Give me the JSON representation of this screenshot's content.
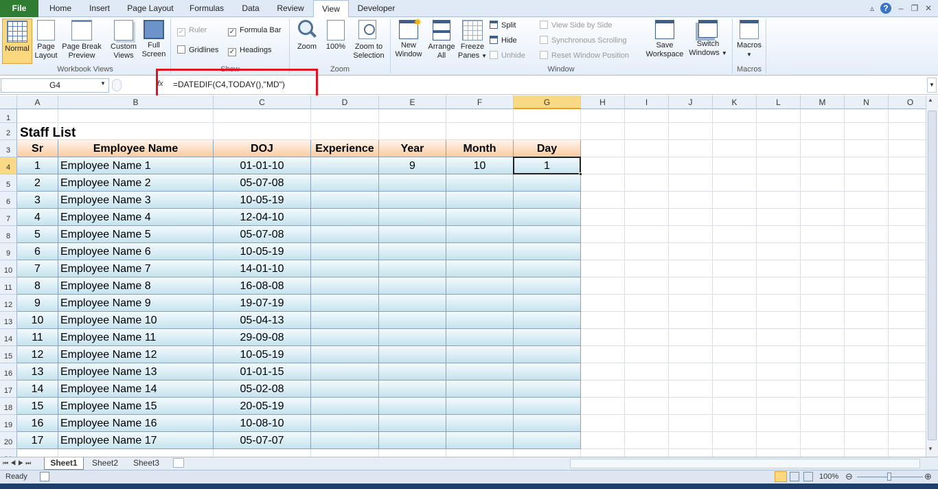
{
  "tabs": {
    "file": "File",
    "items": [
      "Home",
      "Insert",
      "Page Layout",
      "Formulas",
      "Data",
      "Review",
      "View",
      "Developer"
    ]
  },
  "ribbon": {
    "workbook_views": {
      "label": "Workbook Views",
      "normal": "Normal",
      "page_layout": [
        "Page",
        "Layout"
      ],
      "page_break": [
        "Page Break",
        "Preview"
      ],
      "custom_views": [
        "Custom",
        "Views"
      ],
      "full_screen": [
        "Full",
        "Screen"
      ]
    },
    "show": {
      "label": "Show",
      "ruler": "Ruler",
      "formula_bar": "Formula Bar",
      "gridlines": "Gridlines",
      "headings": "Headings"
    },
    "zoom": {
      "label": "Zoom",
      "zoom": "Zoom",
      "hundred": "100%",
      "zoom_selection": [
        "Zoom to",
        "Selection"
      ]
    },
    "window": {
      "label": "Window",
      "new_window": [
        "New",
        "Window"
      ],
      "arrange_all": [
        "Arrange",
        "All"
      ],
      "freeze_panes": [
        "Freeze",
        "Panes"
      ],
      "split": "Split",
      "hide": "Hide",
      "unhide": "Unhide",
      "side_by_side": "View Side by Side",
      "sync_scroll": "Synchronous Scrolling",
      "reset_position": "Reset Window Position",
      "save_workspace": [
        "Save",
        "Workspace"
      ],
      "switch_windows": [
        "Switch",
        "Windows"
      ]
    },
    "macros": {
      "label": "Macros",
      "macros": "Macros"
    }
  },
  "formula_bar": {
    "name_box": "G4",
    "fx": "fx",
    "formula": "=DATEDIF(C4,TODAY(),\"MD\")"
  },
  "columns": [
    "A",
    "B",
    "C",
    "D",
    "E",
    "F",
    "G",
    "H",
    "I",
    "J",
    "K",
    "L",
    "M",
    "N",
    "O"
  ],
  "selected_column": "G",
  "selected_row": 4,
  "sheet": {
    "title": "Staff List",
    "headers": [
      "Sr",
      "Employee Name",
      "DOJ",
      "Experience",
      "Year",
      "Month",
      "Day"
    ],
    "rows": [
      [
        "1",
        "Employee Name 1",
        "01-01-10",
        "",
        "9",
        "10",
        "1"
      ],
      [
        "2",
        "Employee Name 2",
        "05-07-08",
        "",
        "",
        "",
        ""
      ],
      [
        "3",
        "Employee Name 3",
        "10-05-19",
        "",
        "",
        "",
        ""
      ],
      [
        "4",
        "Employee Name 4",
        "12-04-10",
        "",
        "",
        "",
        ""
      ],
      [
        "5",
        "Employee Name 5",
        "05-07-08",
        "",
        "",
        "",
        ""
      ],
      [
        "6",
        "Employee Name 6",
        "10-05-19",
        "",
        "",
        "",
        ""
      ],
      [
        "7",
        "Employee Name 7",
        "14-01-10",
        "",
        "",
        "",
        ""
      ],
      [
        "8",
        "Employee Name 8",
        "16-08-08",
        "",
        "",
        "",
        ""
      ],
      [
        "9",
        "Employee Name 9",
        "19-07-19",
        "",
        "",
        "",
        ""
      ],
      [
        "10",
        "Employee Name 10",
        "05-04-13",
        "",
        "",
        "",
        ""
      ],
      [
        "11",
        "Employee Name 11",
        "29-09-08",
        "",
        "",
        "",
        ""
      ],
      [
        "12",
        "Employee Name 12",
        "10-05-19",
        "",
        "",
        "",
        ""
      ],
      [
        "13",
        "Employee Name 13",
        "01-01-15",
        "",
        "",
        "",
        ""
      ],
      [
        "14",
        "Employee Name 14",
        "05-02-08",
        "",
        "",
        "",
        ""
      ],
      [
        "15",
        "Employee Name 15",
        "20-05-19",
        "",
        "",
        "",
        ""
      ],
      [
        "16",
        "Employee Name 16",
        "10-08-10",
        "",
        "",
        "",
        ""
      ],
      [
        "17",
        "Employee Name 17",
        "05-07-07",
        "",
        "",
        "",
        ""
      ]
    ]
  },
  "sheet_tabs": [
    "Sheet1",
    "Sheet2",
    "Sheet3"
  ],
  "status": {
    "ready": "Ready",
    "zoom": "100%"
  },
  "colors": {
    "file_tab": "#2f7d32",
    "highlight_box": "#e0141e",
    "header_fill": "#fbcba0",
    "row_fill": "#c5e3ee",
    "selected_header": "#f9d984"
  }
}
